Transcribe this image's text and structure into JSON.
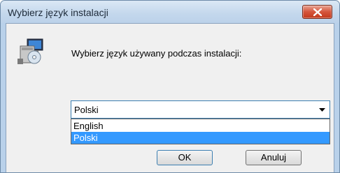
{
  "window": {
    "title": "Wybierz język instalacji"
  },
  "dialog": {
    "prompt": "Wybierz język używany podczas instalacji:",
    "language_select": {
      "value": "Polski",
      "options": [
        "English",
        "Polski"
      ],
      "highlighted_option": "Polski"
    },
    "ok_label": "OK",
    "cancel_label": "Anuluj"
  },
  "icons": {
    "close": "close-icon",
    "setup": "setup-installer-icon",
    "dropdown_arrow": "chevron-down-icon"
  },
  "colors": {
    "selection": "#3399ff",
    "close_button": "#c2391c"
  }
}
